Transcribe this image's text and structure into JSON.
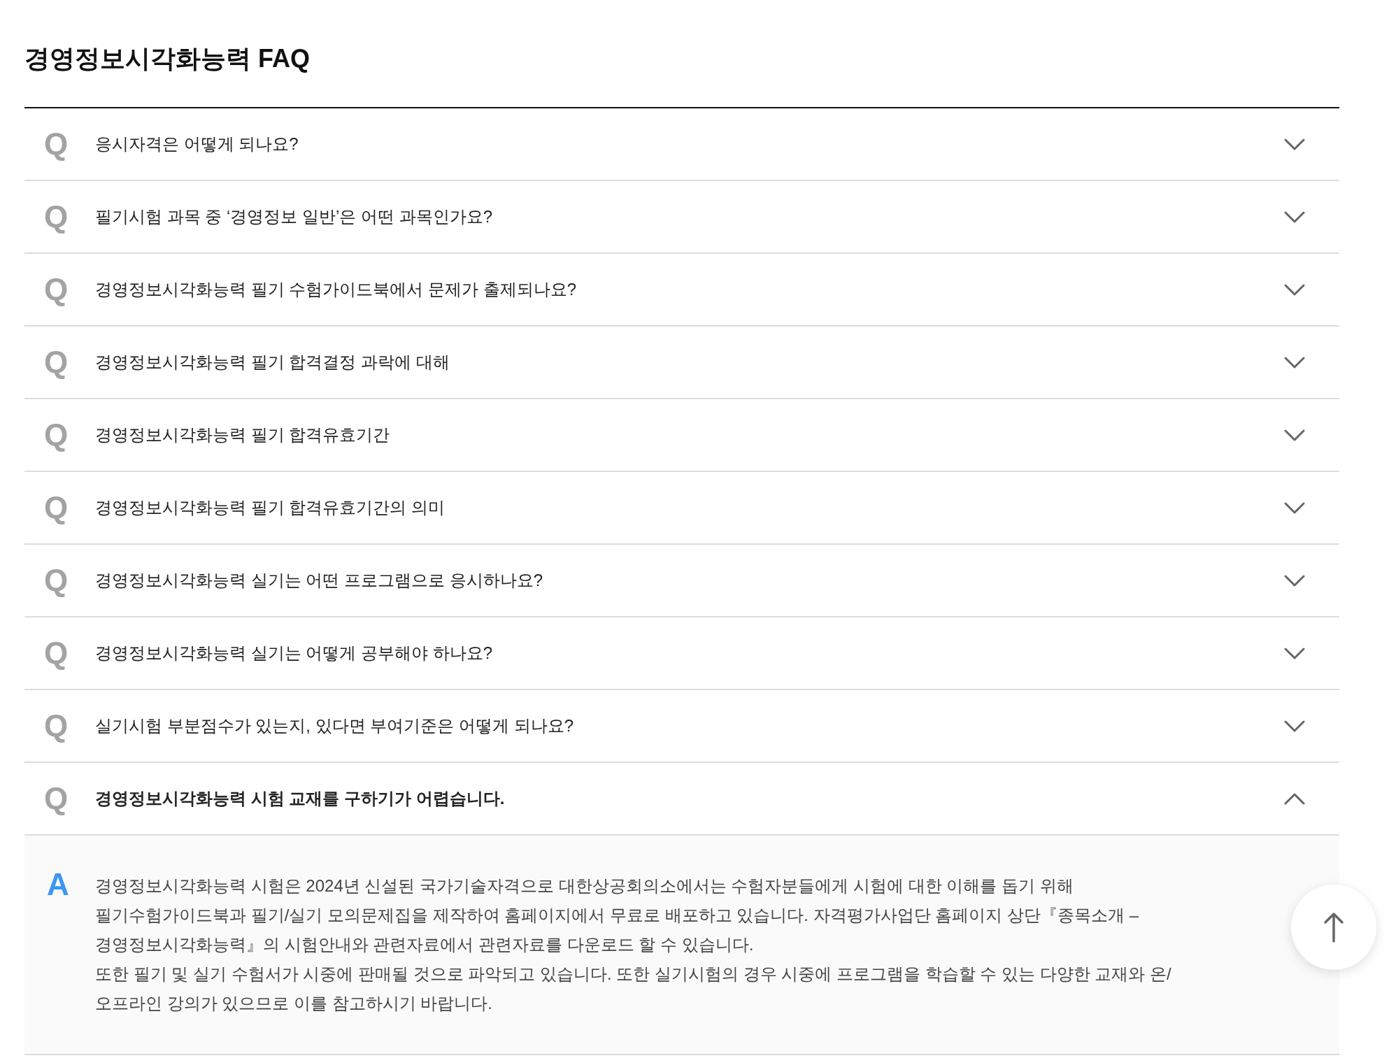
{
  "page": {
    "title": "경영정보시각화능력 FAQ"
  },
  "faq": [
    {
      "marker": "Q",
      "question": "응시자격은 어떻게 되나요?",
      "expanded": false
    },
    {
      "marker": "Q",
      "question": "필기시험 과목 중 ‘경영정보 일반’은 어떤 과목인가요?",
      "expanded": false
    },
    {
      "marker": "Q",
      "question": "경영정보시각화능력 필기 수험가이드북에서 문제가 출제되나요?",
      "expanded": false
    },
    {
      "marker": "Q",
      "question": "경영정보시각화능력 필기 합격결정 과락에 대해",
      "expanded": false
    },
    {
      "marker": "Q",
      "question": "경영정보시각화능력 필기 합격유효기간",
      "expanded": false
    },
    {
      "marker": "Q",
      "question": "경영정보시각화능력 필기 합격유효기간의 의미",
      "expanded": false
    },
    {
      "marker": "Q",
      "question": "경영정보시각화능력 실기는 어떤 프로그램으로 응시하나요?",
      "expanded": false
    },
    {
      "marker": "Q",
      "question": "경영정보시각화능력 실기는 어떻게 공부해야 하나요?",
      "expanded": false
    },
    {
      "marker": "Q",
      "question": "실기시험 부분점수가 있는지, 있다면 부여기준은 어떻게 되나요?",
      "expanded": false
    },
    {
      "marker": "Q",
      "question": "경영정보시각화능력 시험 교재를 구하기가 어렵습니다.",
      "expanded": true,
      "answer": {
        "marker": "A",
        "paragraphs": [
          "경영정보시각화능력 시험은 2024년 신설된 국가기술자격으로 대한상공회의소에서는 수험자분들에게 시험에 대한 이해를 돕기 위해 필기수험가이드북과 필기/실기 모의문제집을 제작하여 홈페이지에서 무료로 배포하고 있습니다. 자격평가사업단 홈페이지 상단『종목소개 – 경영정보시각화능력』의 시험안내와 관련자료에서 관련자료를 다운로드 할 수 있습니다.",
          "또한 필기 및 실기 수험서가 시중에 판매될 것으로 파악되고 있습니다. 또한 실기시험의 경우 시중에 프로그램을 학습할 수 있는 다양한 교재와 온/오프라인 강의가 있으므로 이를 참고하시기 바랍니다."
        ]
      }
    }
  ]
}
